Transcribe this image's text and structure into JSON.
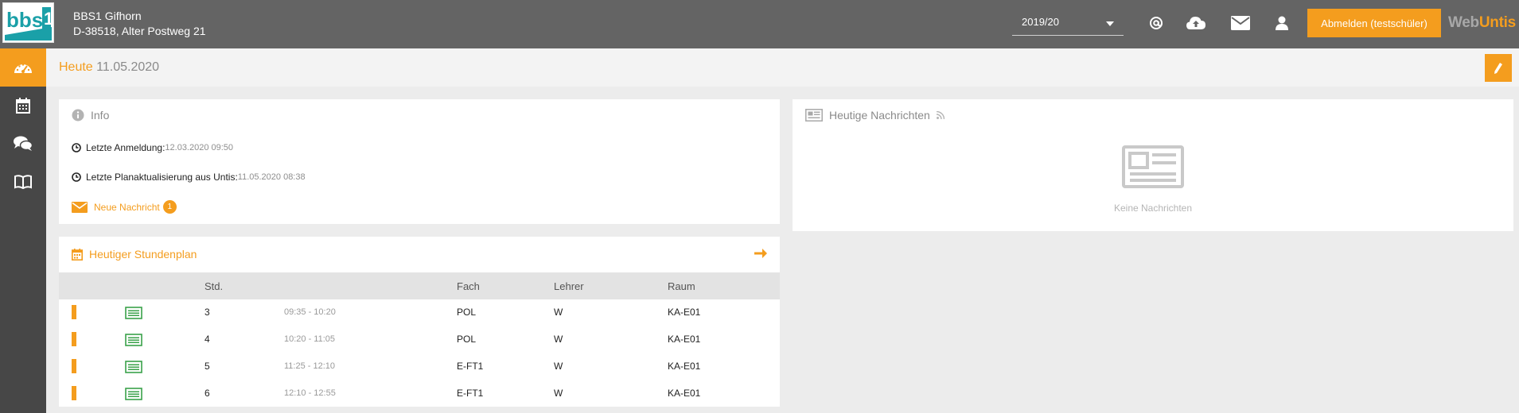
{
  "school": {
    "name": "BBS1 Gifhorn",
    "address": "D-38518, Alter Postweg 21"
  },
  "header": {
    "school_year": "2019/20",
    "logout_label": "Abmelden (testschüler)",
    "brand_part1": "Web",
    "brand_part2": "Untis",
    "icons": [
      "at-icon",
      "cloud-upload-icon",
      "envelope-icon",
      "user-icon"
    ]
  },
  "sidebar": {
    "items": [
      "dashboard-icon",
      "calendar-icon",
      "chat-icon",
      "book-icon"
    ]
  },
  "page": {
    "title": "Heute",
    "date": "11.05.2020"
  },
  "info": {
    "title": "Info",
    "last_login_label": "Letzte Anmeldung:",
    "last_login_value": "12.03.2020 09:50",
    "last_update_label": "Letzte Planaktualisierung aus Untis:",
    "last_update_value": "11.05.2020 08:38",
    "new_message_label": "Neue Nachricht",
    "new_message_count": "1"
  },
  "timetable": {
    "title": "Heutiger Stundenplan",
    "columns": {
      "std": "Std.",
      "fach": "Fach",
      "lehrer": "Lehrer",
      "raum": "Raum"
    },
    "rows": [
      {
        "std": "3",
        "time": "09:35 - 10:20",
        "fach": "POL",
        "lehrer": "W",
        "raum": "KA-E01"
      },
      {
        "std": "4",
        "time": "10:20 - 11:05",
        "fach": "POL",
        "lehrer": "W",
        "raum": "KA-E01"
      },
      {
        "std": "5",
        "time": "11:25 - 12:10",
        "fach": "E-FT1",
        "lehrer": "W",
        "raum": "KA-E01"
      },
      {
        "std": "6",
        "time": "12:10 - 12:55",
        "fach": "E-FT1",
        "lehrer": "W",
        "raum": "KA-E01"
      }
    ]
  },
  "news": {
    "title": "Heutige Nachrichten",
    "empty_label": "Keine Nachrichten"
  },
  "colors": {
    "accent": "#f49d1e",
    "topbar": "#646464",
    "sidebar": "#474747",
    "lesson_icon": "#3aa24a"
  }
}
